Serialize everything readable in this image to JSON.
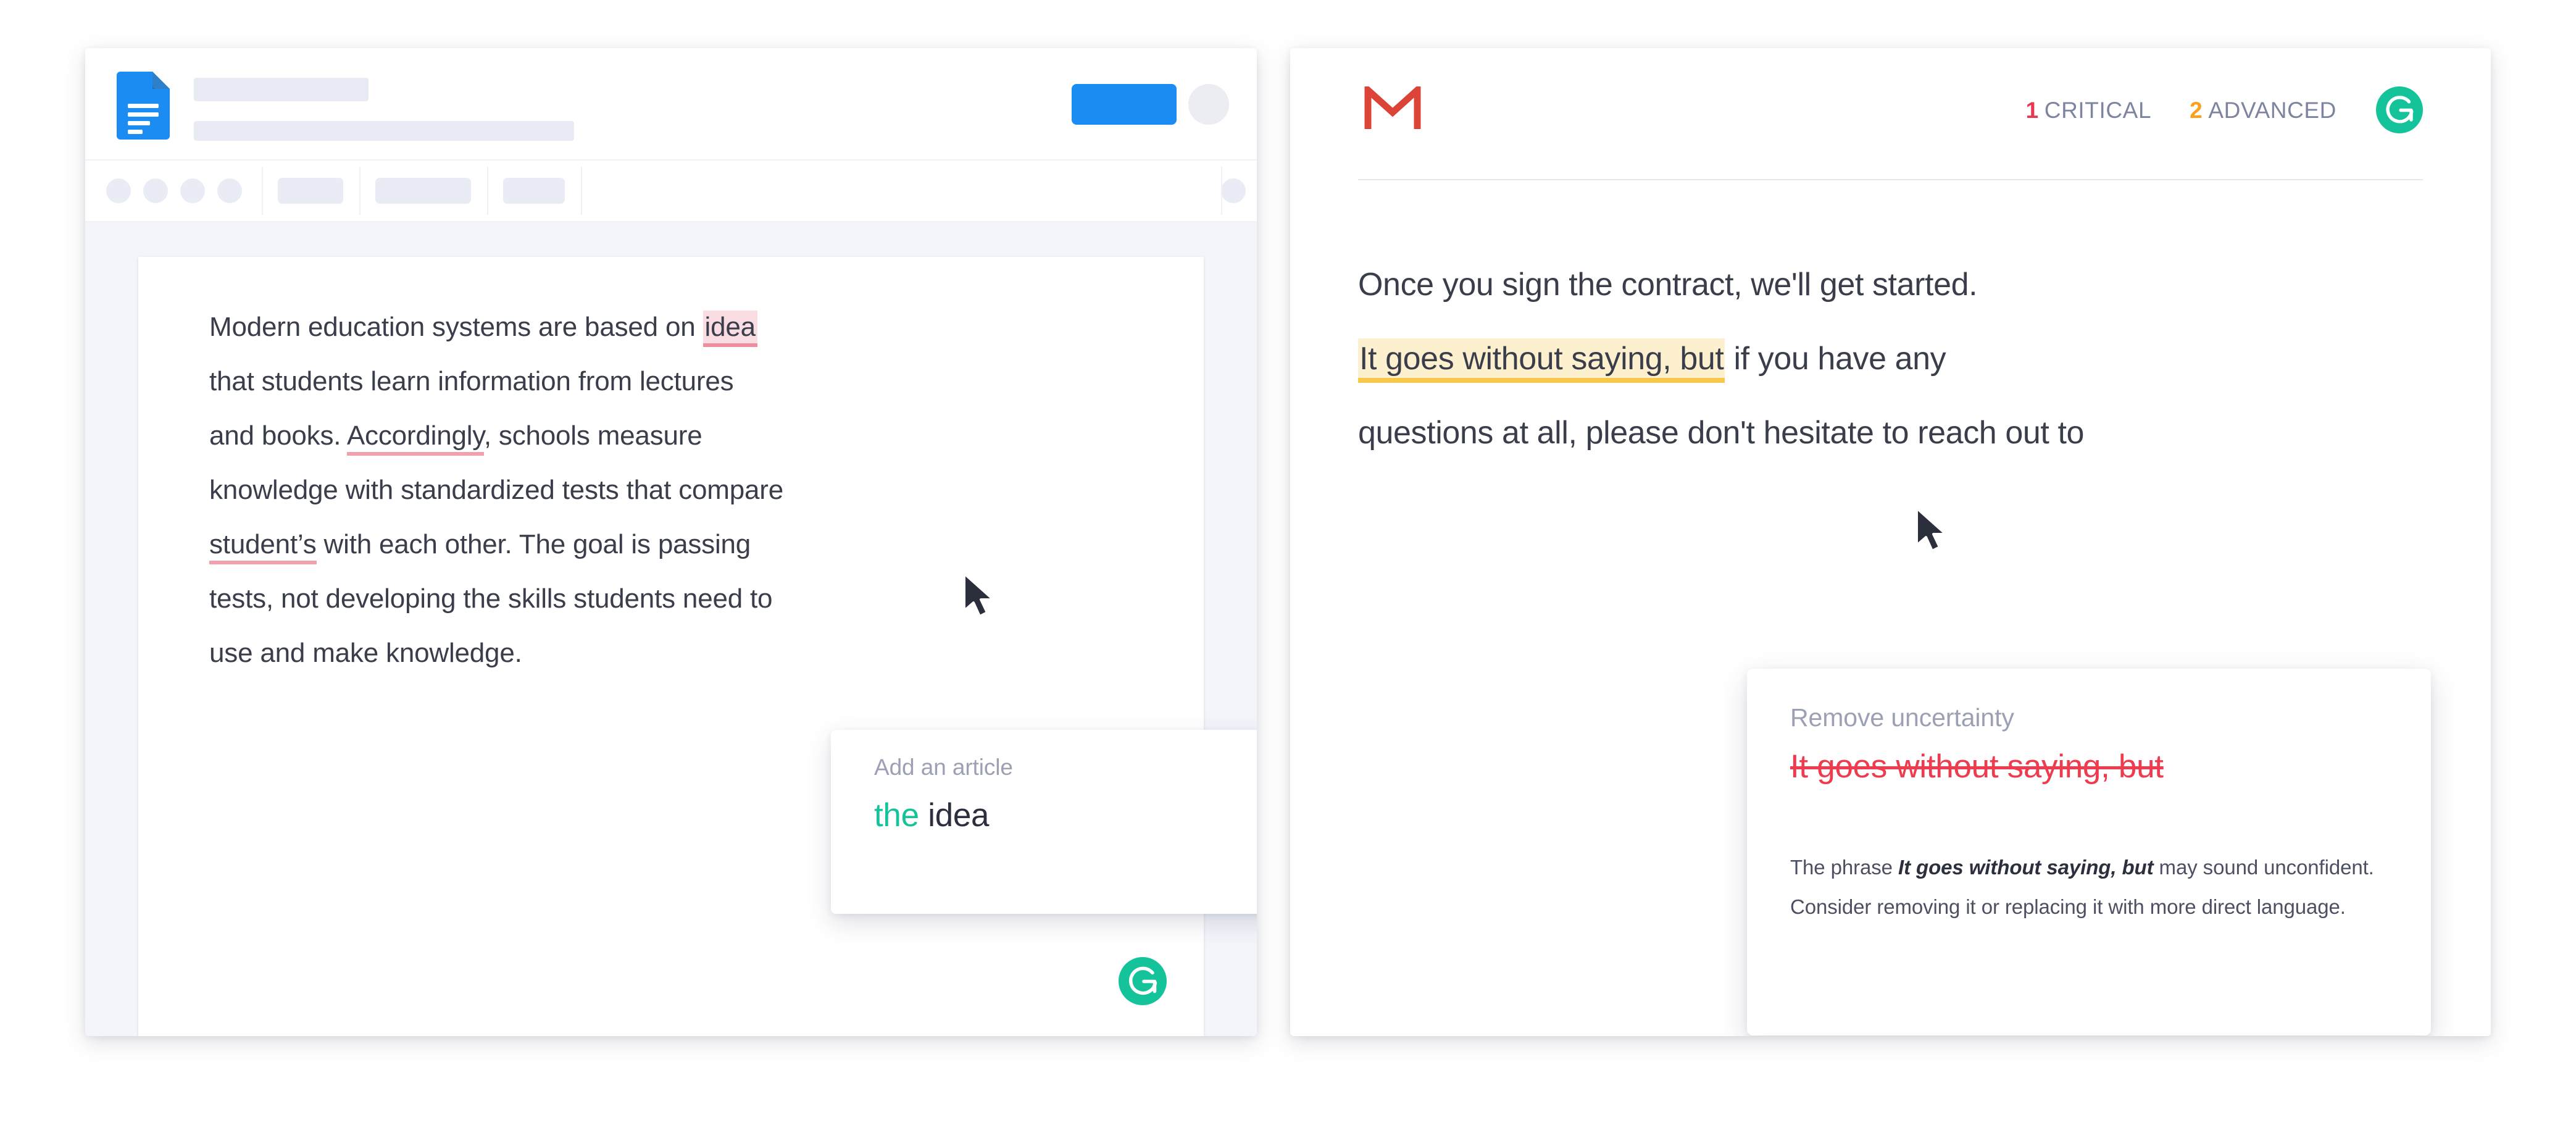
{
  "colors": {
    "grammarly_green": "#15c39a",
    "docs_blue": "#1a8cf2",
    "gmail_red": "#db4437",
    "critical_red": "#e8384f",
    "advanced_orange": "#f9a11b",
    "error_underline_pink": "#f1a0ad",
    "error_highlight_pink": "#fadde2",
    "advanced_highlight_yellow": "#fdf0cf",
    "advanced_underline_yellow": "#f7c94b",
    "strike_red": "#ee3b4e",
    "muted_label": "#9ba0b5",
    "body_text": "#3a3d4a",
    "canvas_bg": "#f3f5fb",
    "placeholder_grey": "#e9ecf4"
  },
  "docs": {
    "app_icon": "google-docs-icon",
    "title_placeholder": "document-title-placeholder",
    "menu_placeholder": "document-menubar-placeholder",
    "share_label": "",
    "toolbar": {
      "groups": [
        {
          "name": "history-tools",
          "type": "circles",
          "count": 4
        },
        {
          "name": "zoom-control",
          "type": "pill",
          "width_class": "w1"
        },
        {
          "name": "font-control",
          "type": "pill",
          "width_class": "w2"
        },
        {
          "name": "font-size-control",
          "type": "pill",
          "width_class": "w3"
        },
        {
          "name": "spacer",
          "type": "spacer"
        },
        {
          "name": "mode-control",
          "type": "circle"
        }
      ]
    },
    "document": {
      "lines": [
        {
          "id": "l1",
          "parts": [
            {
              "text": "Modern education systems are based on ",
              "style": "plain"
            },
            {
              "text": "idea",
              "style": "error-highlight"
            }
          ]
        },
        {
          "id": "l2",
          "parts": [
            {
              "text": "that students learn information from lectures",
              "style": "plain"
            }
          ]
        },
        {
          "id": "l3",
          "parts": [
            {
              "text": "and books. ",
              "style": "plain"
            },
            {
              "text": "Accordingly",
              "style": "error-underline"
            },
            {
              "text": ", schools measure",
              "style": "plain"
            }
          ]
        },
        {
          "id": "l4",
          "parts": [
            {
              "text": "knowledge with standardized tests that compare",
              "style": "plain"
            }
          ]
        },
        {
          "id": "l5",
          "parts": [
            {
              "text": "student’s",
              "style": "error-underline"
            },
            {
              "text": " with each other. The goal is passing",
              "style": "plain"
            }
          ]
        },
        {
          "id": "l6",
          "parts": [
            {
              "text": "tests, not developing the skills students need to",
              "style": "plain"
            }
          ]
        },
        {
          "id": "l7",
          "parts": [
            {
              "text": "use and make knowledge.",
              "style": "plain"
            }
          ]
        }
      ],
      "grammarly_badge": "grammarly-logo-icon"
    },
    "popup": {
      "title": "Add an article",
      "replacement_insert": "the",
      "replacement_rest": "idea"
    }
  },
  "gmail": {
    "app_icon": "gmail-m-icon",
    "stats": [
      {
        "id": "critical",
        "count": "1",
        "label": "CRITICAL"
      },
      {
        "id": "advanced",
        "count": "2",
        "label": "ADVANCED"
      }
    ],
    "grammarly_badge": "grammarly-logo-icon",
    "message": {
      "lines": [
        {
          "id": "m1",
          "parts": [
            {
              "text": "Once you sign the contract, we'll get started.",
              "style": "plain"
            }
          ]
        },
        {
          "id": "m2",
          "parts": [
            {
              "text": "It goes without saying, but",
              "style": "advanced-highlight"
            },
            {
              "text": " if you have any",
              "style": "plain"
            }
          ]
        },
        {
          "id": "m3",
          "parts": [
            {
              "text": "questions at all, please don't hesitate to reach out to",
              "style": "plain"
            }
          ]
        }
      ]
    },
    "suggestion_card": {
      "title": "Remove uncertainty",
      "strike_text": "It goes without saying, but",
      "explain_pre": "The phrase ",
      "explain_bold": "It goes without saying, but",
      "explain_post": " may sound unconfident. Consider removing it or replacing it with more direct language."
    }
  },
  "cursors": [
    {
      "id": "docs-cursor",
      "name": "mouse-pointer-icon"
    },
    {
      "id": "gmail-cursor",
      "name": "mouse-pointer-icon"
    }
  ]
}
